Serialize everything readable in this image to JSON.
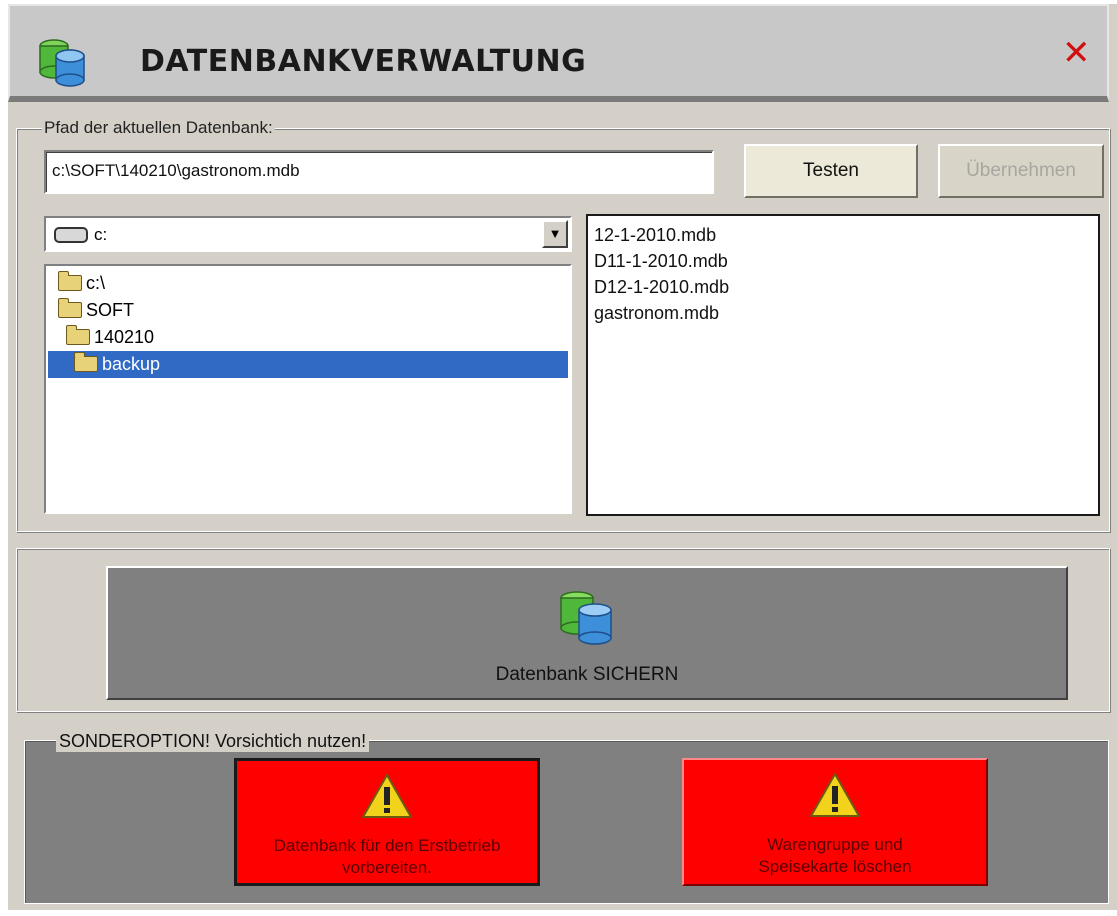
{
  "window": {
    "title": "DATENBANKVERWALTUNG",
    "close_icon": "close-x-icon",
    "app_icon": "database-icon"
  },
  "path_group": {
    "label": "Pfad der aktuellen Datenbank:",
    "path_value": "c:\\SOFT\\140210\\gastronom.mdb",
    "test_button": "Testen",
    "apply_button": "Übernehmen"
  },
  "drive_select": {
    "selected": "c:",
    "icon": "drive-icon"
  },
  "folder_tree": {
    "nodes": [
      {
        "label": "c:\\",
        "selected": false
      },
      {
        "label": "SOFT",
        "selected": false
      },
      {
        "label": "140210",
        "selected": false
      },
      {
        "label": "backup",
        "selected": true
      }
    ]
  },
  "file_list": {
    "files": [
      "12-1-2010.mdb",
      "D11-1-2010.mdb",
      "D12-1-2010.mdb",
      "gastronom.mdb"
    ]
  },
  "backup": {
    "label": "Datenbank SICHERN",
    "icon": "database-icon"
  },
  "special": {
    "label": "SONDEROPTION! Vorsichtich nutzen!",
    "prepare_button": "Datenbank für den Erstbetrieb vorbereiten.",
    "delete_button": "Warengruppe und Speisekarte löschen",
    "warning_icon": "warning-icon"
  },
  "colors": {
    "accent_selection": "#316ac5",
    "danger": "#ff0000",
    "close": "#d01010"
  }
}
